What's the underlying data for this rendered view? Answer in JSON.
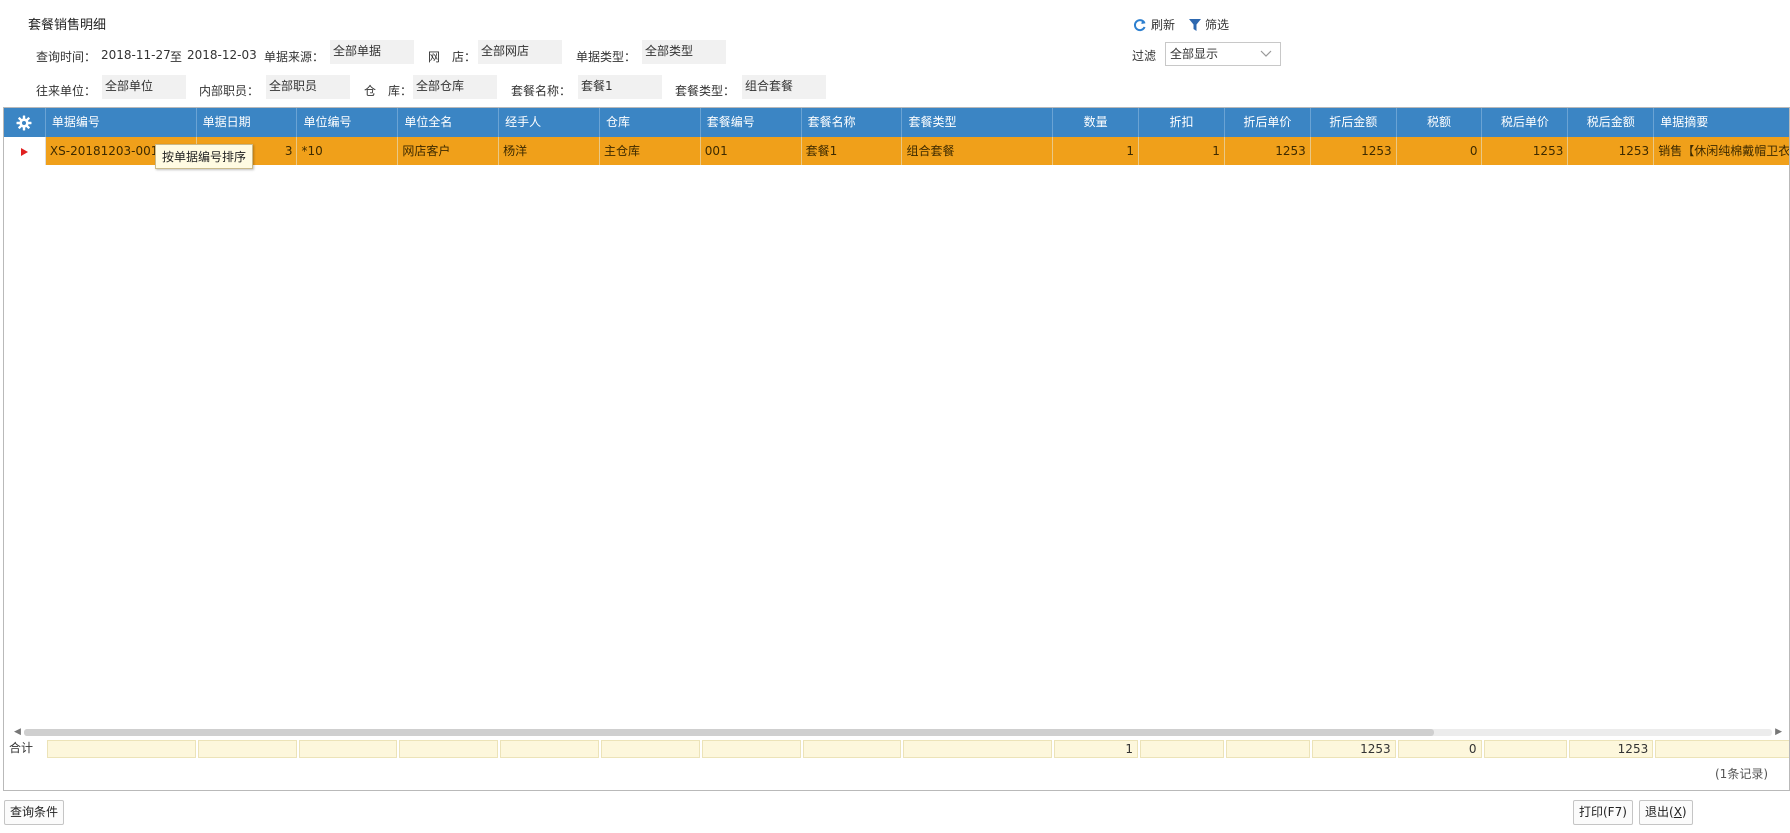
{
  "title": "套餐销售明细",
  "toolbar": {
    "refresh_label": "刷新",
    "filter_label": "筛选"
  },
  "filter": {
    "label": "过滤",
    "value": "全部显示"
  },
  "conditions": {
    "time_label": "查询时间：",
    "date_from": "2018-11-27",
    "to_label": "至",
    "date_to": "2018-12-03",
    "source_label": "单据来源：",
    "source_value": "全部单据",
    "shop_label": "网　店：",
    "shop_value": "全部网店",
    "doc_type_label": "单据类型：",
    "doc_type_value": "全部类型",
    "partner_label": "往来单位：",
    "partner_value": "全部单位",
    "staff_label": "内部职员：",
    "staff_value": "全部职员",
    "warehouse_label": "仓　库：",
    "warehouse_value": "全部仓库",
    "package_name_label": "套餐名称：",
    "package_name_value": "套餐1",
    "package_type_label": "套餐类型：",
    "package_type_value": "组合套餐"
  },
  "columns": [
    "单据编号",
    "单据日期",
    "单位编号",
    "单位全名",
    "经手人",
    "仓库",
    "套餐编号",
    "套餐名称",
    "套餐类型",
    "数量",
    "折扣",
    "折后单价",
    "折后金额",
    "税额",
    "税后单价",
    "税后金额",
    "单据摘要"
  ],
  "rows": [
    {
      "doc_no": "XS-20181203-001",
      "date": "3",
      "unit_code": "*10",
      "unit_name": "网店客户",
      "handler": "杨洋",
      "warehouse": "主仓库",
      "pkg_code": "001",
      "pkg_name": "套餐1",
      "pkg_type": "组合套餐",
      "qty": "1",
      "discount": "1",
      "disc_price": "1253",
      "disc_amount": "1253",
      "tax": "0",
      "tax_price": "1253",
      "tax_amount": "1253",
      "summary": "销售【休闲纯棉戴帽卫衣"
    }
  ],
  "totals": {
    "label": "合计",
    "qty": "1",
    "disc_amount": "1253",
    "tax": "0",
    "tax_amount": "1253"
  },
  "tooltip": "按单据编号排序",
  "record_count": "(1条记录)",
  "buttons": {
    "query": "查询条件",
    "print": "打印(F7)",
    "exit_prefix": "退出(",
    "exit_key": "X",
    "exit_suffix": ")"
  },
  "colors": {
    "header_bg": "#3b85c4",
    "selected_row": "#f0a01a",
    "total_bg": "#fdf7dc"
  },
  "icons": {
    "settings": "gear-icon",
    "refresh": "refresh-icon",
    "filter": "funnel-icon",
    "row_marker": "triangle-right-icon"
  }
}
